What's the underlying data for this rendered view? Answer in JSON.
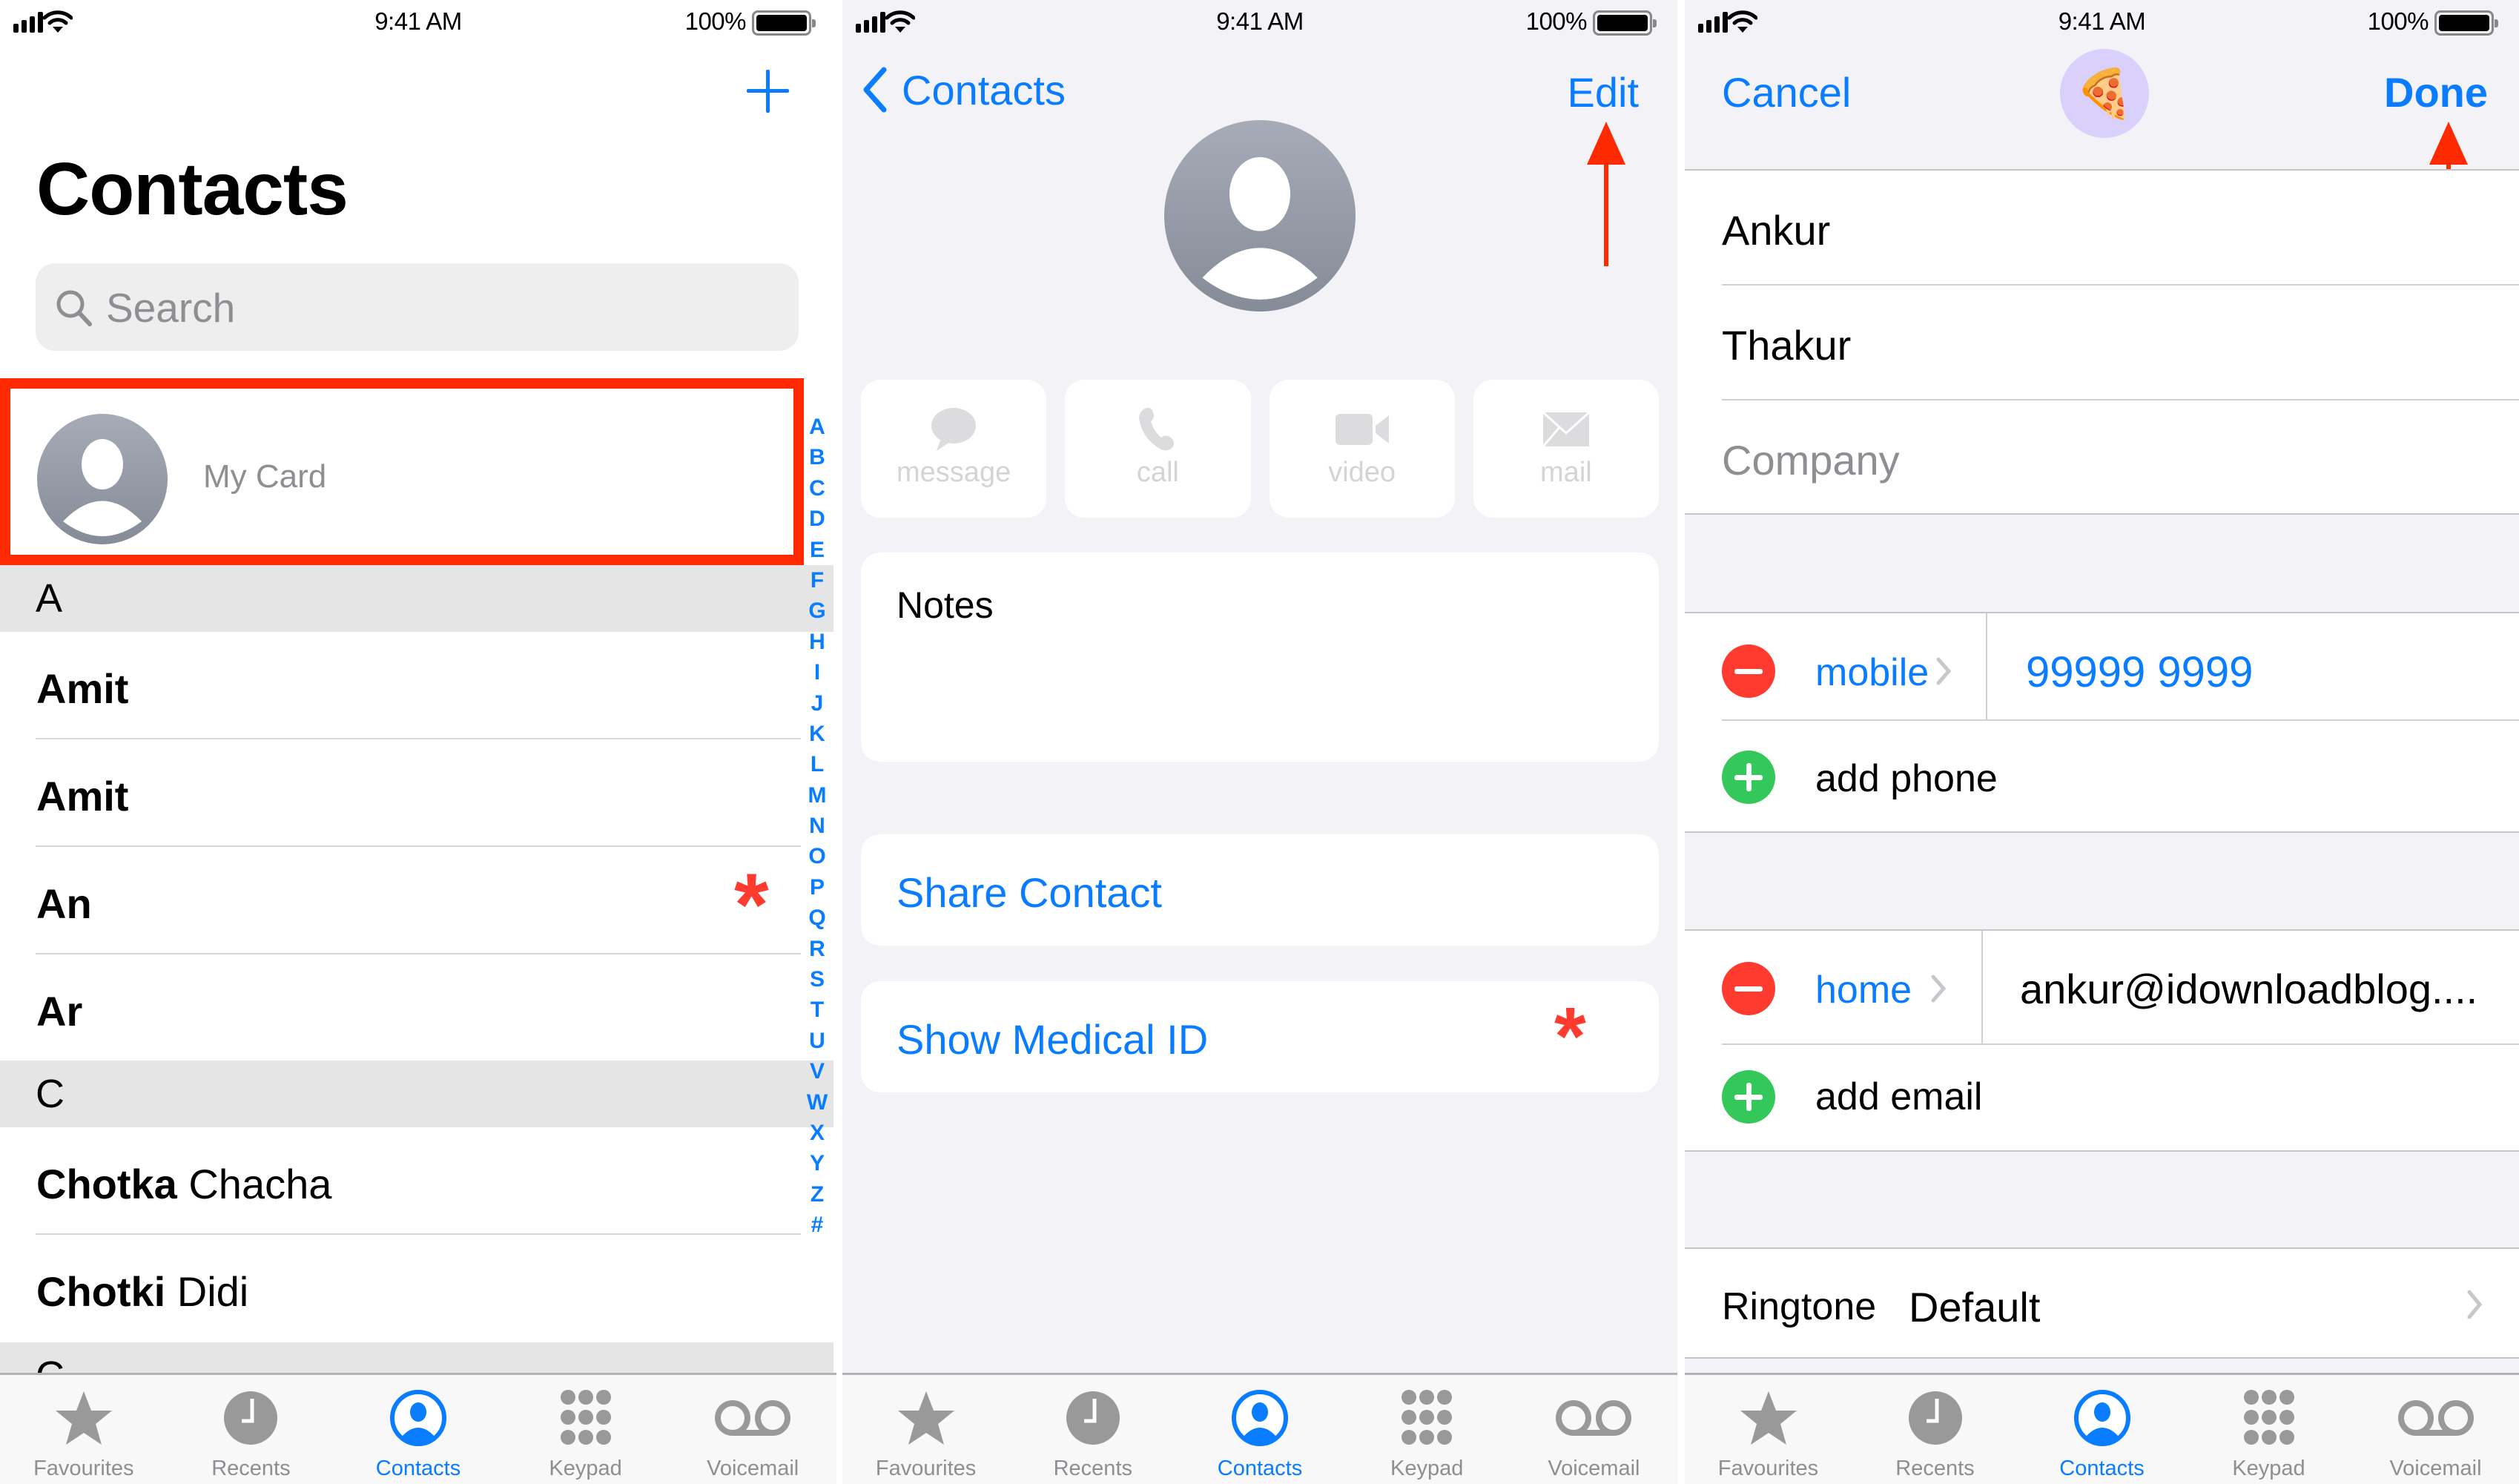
{
  "status_bar": {
    "time": "9:41 AM",
    "battery_percent": "100%",
    "battery_level": 1.0,
    "signal_bars": 4
  },
  "colors": {
    "accent": "#0a7cff",
    "destructive": "#ff3b30",
    "add": "#34c759",
    "annotation": "#ff2a00",
    "grouped_background": "#f2f2f7",
    "secondary_text": "#8e8e93"
  },
  "contacts_list": {
    "title": "Contacts",
    "add_icon": "plus-icon",
    "search": {
      "placeholder": "Search",
      "icon": "magnifier-icon"
    },
    "my_card": {
      "label": "My Card",
      "avatar_icon": "person-placeholder-icon",
      "highlighted": true
    },
    "sections": [
      {
        "letter": "A",
        "contacts": [
          {
            "first": "Amit",
            "last": "",
            "medical_id": false
          },
          {
            "first": "Amit",
            "last": "",
            "medical_id": false
          },
          {
            "first": "An",
            "last": "",
            "medical_id": true
          },
          {
            "first": "Ar",
            "last": "",
            "medical_id": false
          }
        ]
      },
      {
        "letter": "C",
        "contacts": [
          {
            "first": "Chotka",
            "last": "Chacha",
            "medical_id": false
          },
          {
            "first": "Chotki",
            "last": "Didi",
            "medical_id": false
          }
        ]
      },
      {
        "letter": "C",
        "contacts": []
      }
    ],
    "index_letters": [
      "A",
      "B",
      "C",
      "D",
      "E",
      "F",
      "G",
      "H",
      "I",
      "J",
      "K",
      "L",
      "M",
      "N",
      "O",
      "P",
      "Q",
      "R",
      "S",
      "T",
      "U",
      "V",
      "W",
      "X",
      "Y",
      "Z",
      "#"
    ]
  },
  "contact_detail": {
    "back_label": "Contacts",
    "edit_label": "Edit",
    "avatar_icon": "person-placeholder-icon",
    "actions": [
      {
        "label": "message",
        "icon": "message-bubble-icon",
        "enabled": false
      },
      {
        "label": "call",
        "icon": "phone-icon",
        "enabled": false
      },
      {
        "label": "video",
        "icon": "video-camera-icon",
        "enabled": false
      },
      {
        "label": "mail",
        "icon": "envelope-icon",
        "enabled": false
      }
    ],
    "notes_label": "Notes",
    "share_contact": "Share Contact",
    "show_medical_id": "Show Medical ID",
    "annotation": "red-arrow-pointing-to-edit"
  },
  "edit_card": {
    "cancel_label": "Cancel",
    "done_label": "Done",
    "avatar_emoji": "🍕",
    "first_name": "Ankur",
    "last_name": "Thakur",
    "company_placeholder": "Company",
    "phones": [
      {
        "label": "mobile",
        "value": "99999 9999"
      }
    ],
    "add_phone": "add phone",
    "emails": [
      {
        "label": "home",
        "value": "ankur@idownloadblog...."
      }
    ],
    "add_email": "add email",
    "ringtone": {
      "label": "Ringtone",
      "value": "Default"
    },
    "annotation": "red-arrow-pointing-to-done"
  },
  "tab_bar": {
    "items": [
      {
        "label": "Favourites",
        "icon": "star-icon",
        "active": false
      },
      {
        "label": "Recents",
        "icon": "clock-icon",
        "active": false
      },
      {
        "label": "Contacts",
        "icon": "person-circle-icon",
        "active": true
      },
      {
        "label": "Keypad",
        "icon": "keypad-grid-icon",
        "active": false
      },
      {
        "label": "Voicemail",
        "icon": "voicemail-icon",
        "active": false
      }
    ]
  }
}
